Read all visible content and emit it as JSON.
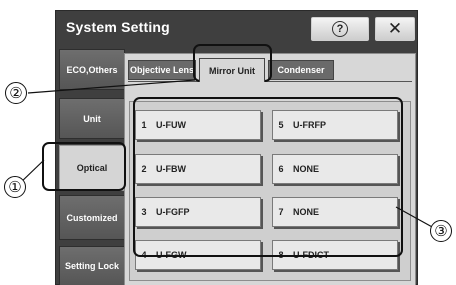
{
  "window": {
    "title": "System Setting",
    "help_glyph": "?",
    "close_glyph": "✕"
  },
  "sidebar": {
    "items": [
      {
        "label": "ECO,Others",
        "active": false
      },
      {
        "label": "Unit",
        "active": false
      },
      {
        "label": "Optical",
        "active": true
      },
      {
        "label": "Customized",
        "active": false
      },
      {
        "label": "Setting Lock",
        "active": false
      }
    ]
  },
  "tabs": [
    {
      "label": "Objective Lens",
      "active": false
    },
    {
      "label": "Mirror Unit",
      "active": true
    },
    {
      "label": "Condenser",
      "active": false
    }
  ],
  "units": [
    {
      "num": "1",
      "name": "U-FUW"
    },
    {
      "num": "2",
      "name": "U-FBW"
    },
    {
      "num": "3",
      "name": "U-FGFP"
    },
    {
      "num": "4",
      "name": "U-FGW"
    },
    {
      "num": "5",
      "name": "U-FRFP"
    },
    {
      "num": "6",
      "name": "NONE"
    },
    {
      "num": "7",
      "name": "NONE"
    },
    {
      "num": "8",
      "name": "U-FDICT"
    }
  ],
  "callouts": {
    "c1": "①",
    "c2": "②",
    "c3": "③"
  },
  "colors": {
    "window_bg": "#3f3f3f",
    "panel_bg": "#d7d7d7",
    "button_face": "#e9e9e9",
    "callout_stroke": "#111111"
  },
  "icons": {
    "help": "help-circle-icon",
    "close": "close-icon"
  }
}
